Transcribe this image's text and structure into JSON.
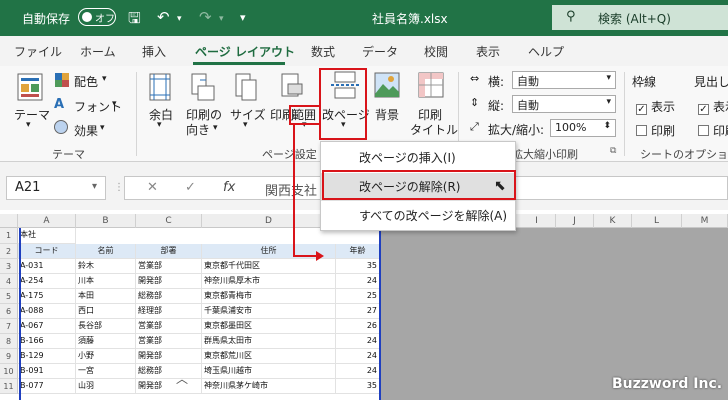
{
  "titlebar": {
    "autosave_label": "自動保存",
    "toggle_label": "オフ",
    "filename": "社員名簿.xlsx",
    "search_placeholder": "検索 (Alt+Q)"
  },
  "tabs": [
    "ファイル",
    "ホーム",
    "挿入",
    "ページ レイアウト",
    "数式",
    "データ",
    "校閲",
    "表示",
    "ヘルプ"
  ],
  "ribbon": {
    "theme": {
      "themes": "テーマ",
      "colors": "配色",
      "fonts": "フォント",
      "effects": "効果",
      "group": "テーマ"
    },
    "page_setup": {
      "margins": "余白",
      "orientation_1": "印刷の",
      "orientation_2": "向き",
      "size": "サイズ",
      "print_area_1": "印刷",
      "print_area_2": "範囲",
      "breaks": "改ページ",
      "background": "背景",
      "print_titles_1": "印刷",
      "print_titles_2": "タイトル",
      "group": "ページ設定"
    },
    "scale": {
      "width_label": "横:",
      "width_value": "自動",
      "height_label": "縦:",
      "height_value": "自動",
      "scale_label": "拡大/縮小:",
      "scale_value": "100%",
      "group": "拡大縮小印刷"
    },
    "sheet_options": {
      "gridlines": "枠線",
      "headings": "見出し",
      "view": "表示",
      "print": "印刷",
      "group": "シートのオプション"
    }
  },
  "formula_bar": {
    "name_box": "A21",
    "cancel": "✕",
    "enter": "✓",
    "fx": "fx",
    "value": "関西支社"
  },
  "dropdown": {
    "items": [
      "改ページの挿入(I)",
      "改ページの解除(R)",
      "すべての改ページを解除(A)"
    ]
  },
  "grid": {
    "columns": [
      "A",
      "B",
      "C",
      "D",
      "E",
      "I",
      "J",
      "K",
      "L",
      "M"
    ],
    "rows": [
      "1",
      "2",
      "3",
      "4",
      "5",
      "6",
      "7",
      "8",
      "9",
      "10",
      "11"
    ],
    "title_cell": "本社",
    "headers": [
      "コード",
      "名前",
      "部署",
      "住所",
      "年齢"
    ],
    "data": [
      [
        "A-031",
        "鈴木",
        "営業部",
        "東京都千代田区",
        "35"
      ],
      [
        "A-254",
        "川本",
        "開発部",
        "神奈川県厚木市",
        "24"
      ],
      [
        "A-175",
        "本田",
        "総務部",
        "東京都青梅市",
        "25"
      ],
      [
        "A-088",
        "西口",
        "経理部",
        "千葉県浦安市",
        "27"
      ],
      [
        "A-067",
        "長谷部",
        "営業部",
        "東京都墨田区",
        "26"
      ],
      [
        "B-166",
        "須藤",
        "営業部",
        "群馬県太田市",
        "24"
      ],
      [
        "B-129",
        "小野",
        "開発部",
        "東京都荒川区",
        "24"
      ],
      [
        "B-091",
        "一宮",
        "総務部",
        "埼玉県川越市",
        "24"
      ],
      [
        "B-077",
        "山羽",
        "開発部",
        "神奈川県茅ケ崎市",
        "35"
      ]
    ]
  },
  "watermark": "Buzzword Inc."
}
